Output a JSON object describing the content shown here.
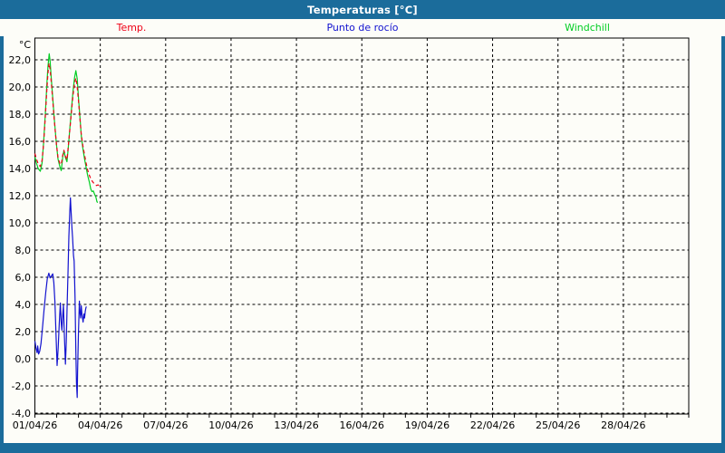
{
  "window": {
    "title": "Temperaturas [°C]",
    "titlebar_color": "#1b6c9b",
    "panel_color": "#fdfdf8"
  },
  "legend": {
    "items": [
      {
        "label": "Temp.",
        "color": "#ee0015"
      },
      {
        "label": "Punto de rocío",
        "color": "#1212cf"
      },
      {
        "label": "Windchill",
        "color": "#00cd22"
      }
    ]
  },
  "chart_data": {
    "type": "line",
    "title": "Temperaturas [°C]",
    "grid": "dashed",
    "legend_position": "top",
    "y_axis": {
      "unit_label": "°C",
      "min": -4,
      "max": 23.7,
      "tick_step": 2,
      "tick_max": 22,
      "tick_min": -4,
      "tick_labels": [
        "22,0",
        "20,0",
        "18,0",
        "16,0",
        "14,0",
        "12,0",
        "10,0",
        "8,0",
        "6,0",
        "4,0",
        "2,0",
        "0,0",
        "-2,0",
        "-4,0"
      ]
    },
    "x_axis": {
      "tick_labels": [
        "01/04/26",
        "04/04/26",
        "07/04/26",
        "10/04/26",
        "13/04/26",
        "16/04/26",
        "19/04/26",
        "22/04/26",
        "25/04/26",
        "28/04/26"
      ],
      "tick_days": [
        0,
        3,
        6,
        9,
        12,
        15,
        18,
        21,
        24,
        27
      ],
      "total_days": 30,
      "minor_tick_every_days": 1
    },
    "series": [
      {
        "name": "Temp.",
        "color": "#ee0015",
        "dashed": true,
        "points": [
          [
            0,
            15.1
          ],
          [
            0.07,
            14.7
          ],
          [
            0.15,
            14.35
          ],
          [
            0.25,
            14.15
          ],
          [
            0.33,
            14.6
          ],
          [
            0.4,
            15.8
          ],
          [
            0.48,
            17.8
          ],
          [
            0.55,
            19.8
          ],
          [
            0.6,
            21.0
          ],
          [
            0.65,
            21.75
          ],
          [
            0.7,
            21.3
          ],
          [
            0.75,
            20.4
          ],
          [
            0.82,
            19.0
          ],
          [
            0.9,
            17.4
          ],
          [
            0.98,
            15.9
          ],
          [
            1.06,
            14.8
          ],
          [
            1.15,
            14.35
          ],
          [
            1.21,
            14.3
          ],
          [
            1.28,
            15.0
          ],
          [
            1.33,
            15.35
          ],
          [
            1.4,
            14.9
          ],
          [
            1.47,
            14.65
          ],
          [
            1.53,
            15.6
          ],
          [
            1.6,
            16.8
          ],
          [
            1.68,
            18.2
          ],
          [
            1.75,
            19.4
          ],
          [
            1.82,
            20.3
          ],
          [
            1.88,
            20.65
          ],
          [
            1.93,
            20.2
          ],
          [
            2.0,
            19.0
          ],
          [
            2.07,
            17.6
          ],
          [
            2.13,
            16.5
          ],
          [
            2.2,
            15.7
          ],
          [
            2.28,
            15.0
          ],
          [
            2.35,
            14.4
          ],
          [
            2.42,
            13.9
          ],
          [
            2.5,
            13.5
          ],
          [
            2.58,
            13.2
          ],
          [
            2.66,
            13.0
          ],
          [
            2.74,
            12.85
          ],
          [
            2.82,
            12.75
          ],
          [
            2.9,
            12.8
          ],
          [
            2.97,
            12.6
          ],
          [
            3.03,
            12.65
          ]
        ]
      },
      {
        "name": "Windchill",
        "color": "#00cd22",
        "dashed": false,
        "points": [
          [
            0,
            14.85
          ],
          [
            0.07,
            14.4
          ],
          [
            0.15,
            14.0
          ],
          [
            0.25,
            13.8
          ],
          [
            0.33,
            14.4
          ],
          [
            0.4,
            15.9
          ],
          [
            0.48,
            18.0
          ],
          [
            0.55,
            20.2
          ],
          [
            0.6,
            21.5
          ],
          [
            0.655,
            22.45
          ],
          [
            0.7,
            21.9
          ],
          [
            0.75,
            20.7
          ],
          [
            0.82,
            19.2
          ],
          [
            0.9,
            17.5
          ],
          [
            0.98,
            15.9
          ],
          [
            1.06,
            14.7
          ],
          [
            1.15,
            14.1
          ],
          [
            1.21,
            13.85
          ],
          [
            1.28,
            14.9
          ],
          [
            1.33,
            15.3
          ],
          [
            1.4,
            14.8
          ],
          [
            1.47,
            14.5
          ],
          [
            1.53,
            15.5
          ],
          [
            1.6,
            16.9
          ],
          [
            1.68,
            18.4
          ],
          [
            1.75,
            19.7
          ],
          [
            1.82,
            20.7
          ],
          [
            1.88,
            21.2
          ],
          [
            1.94,
            20.6
          ],
          [
            2.0,
            19.2
          ],
          [
            2.07,
            17.7
          ],
          [
            2.13,
            16.4
          ],
          [
            2.2,
            15.5
          ],
          [
            2.28,
            14.7
          ],
          [
            2.35,
            14.1
          ],
          [
            2.42,
            13.5
          ],
          [
            2.5,
            13.0
          ],
          [
            2.56,
            12.5
          ],
          [
            2.62,
            12.3
          ],
          [
            2.68,
            12.35
          ],
          [
            2.74,
            12.1
          ],
          [
            2.8,
            11.9
          ],
          [
            2.85,
            11.55
          ],
          [
            2.89,
            11.5
          ]
        ]
      },
      {
        "name": "Punto de rocío",
        "color": "#1212cf",
        "dashed": false,
        "points": [
          [
            0,
            1.3
          ],
          [
            0.05,
            0.8
          ],
          [
            0.1,
            0.45
          ],
          [
            0.13,
            0.95
          ],
          [
            0.17,
            0.35
          ],
          [
            0.22,
            0.55
          ],
          [
            0.28,
            1.1
          ],
          [
            0.35,
            2.3
          ],
          [
            0.42,
            3.6
          ],
          [
            0.5,
            4.9
          ],
          [
            0.57,
            5.9
          ],
          [
            0.64,
            6.3
          ],
          [
            0.7,
            5.95
          ],
          [
            0.76,
            6.1
          ],
          [
            0.82,
            6.25
          ],
          [
            0.87,
            5.6
          ],
          [
            0.92,
            4.2
          ],
          [
            0.97,
            1.8
          ],
          [
            1.02,
            -0.5
          ],
          [
            1.07,
            0.8
          ],
          [
            1.12,
            2.6
          ],
          [
            1.17,
            4.1
          ],
          [
            1.21,
            2.6
          ],
          [
            1.24,
            2.1
          ],
          [
            1.28,
            3.3
          ],
          [
            1.31,
            3.95
          ],
          [
            1.35,
            1.8
          ],
          [
            1.4,
            -0.4
          ],
          [
            1.44,
            1.2
          ],
          [
            1.48,
            4.0
          ],
          [
            1.52,
            6.5
          ],
          [
            1.56,
            9.0
          ],
          [
            1.6,
            10.8
          ],
          [
            1.63,
            11.85
          ],
          [
            1.66,
            10.9
          ],
          [
            1.7,
            9.6
          ],
          [
            1.73,
            8.9
          ],
          [
            1.77,
            7.6
          ],
          [
            1.8,
            7.2
          ],
          [
            1.84,
            4.5
          ],
          [
            1.88,
            0.5
          ],
          [
            1.91,
            -1.8
          ],
          [
            1.94,
            -2.85
          ],
          [
            1.96,
            -1.0
          ],
          [
            2.0,
            2.0
          ],
          [
            2.04,
            4.25
          ],
          [
            2.07,
            3.4
          ],
          [
            2.1,
            3.0
          ],
          [
            2.13,
            3.9
          ],
          [
            2.16,
            3.3
          ],
          [
            2.21,
            2.7
          ],
          [
            2.25,
            3.3
          ],
          [
            2.28,
            3.0
          ],
          [
            2.31,
            3.5
          ],
          [
            2.34,
            3.75
          ],
          [
            2.36,
            3.85
          ]
        ]
      }
    ]
  }
}
